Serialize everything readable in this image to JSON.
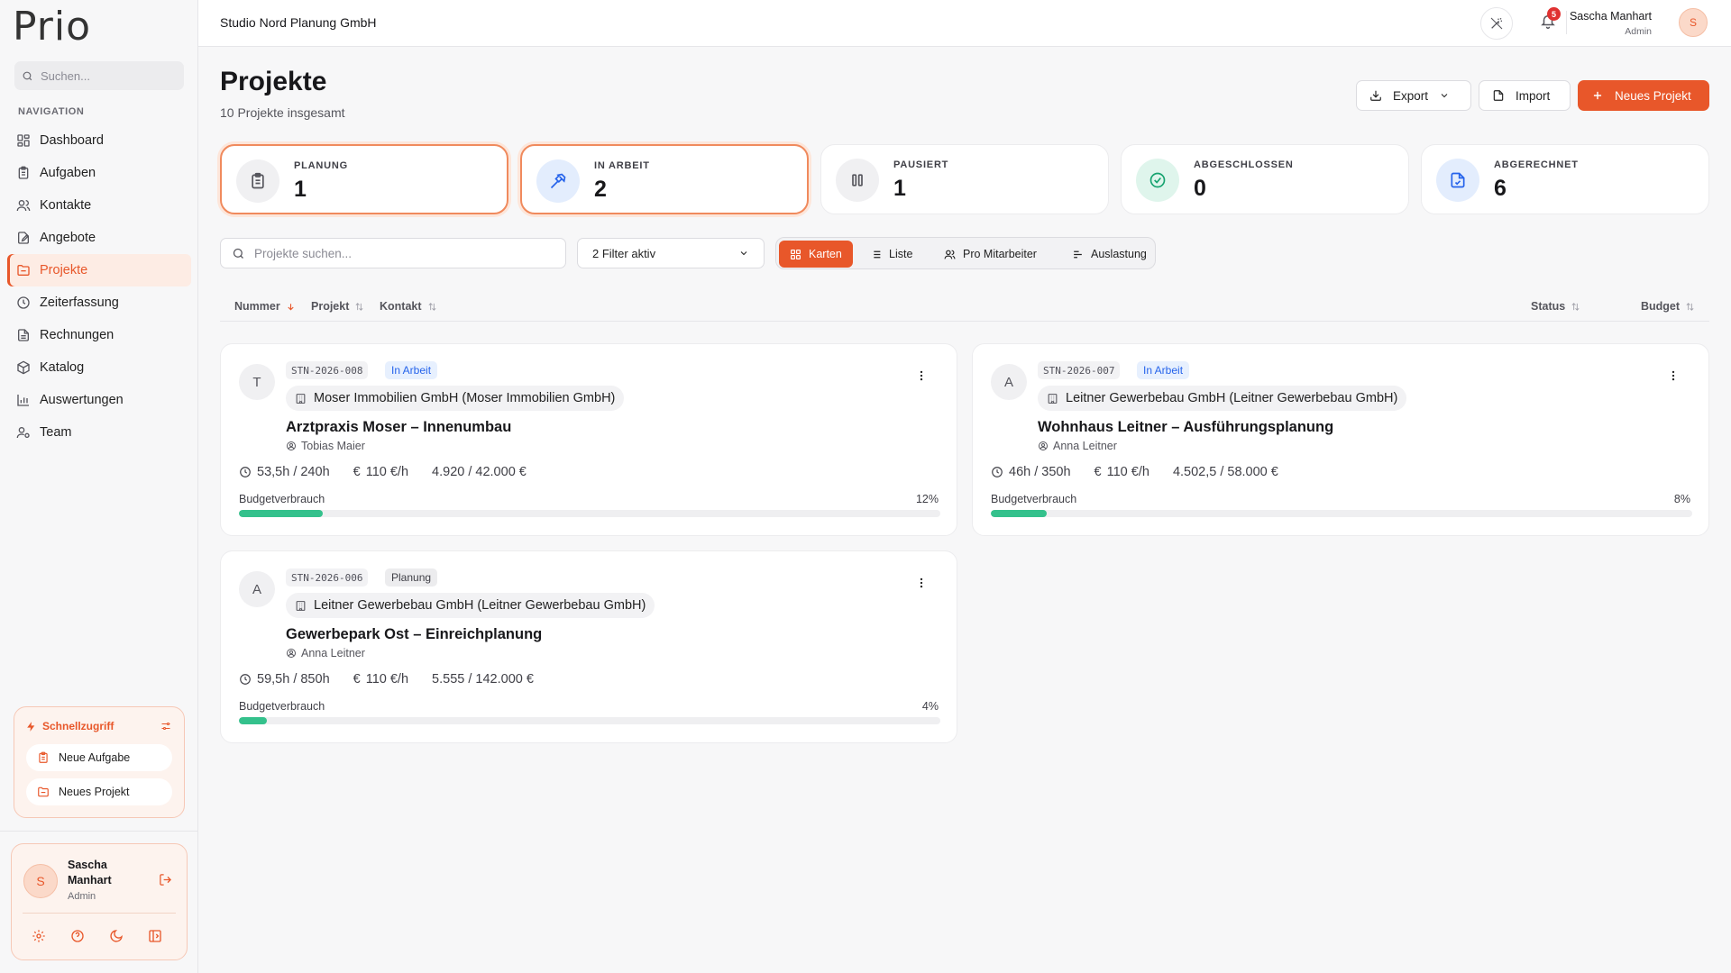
{
  "brand": {
    "logo": "Prio"
  },
  "sidebar": {
    "search_placeholder": "Suchen...",
    "nav_label": "NAVIGATION",
    "items": [
      {
        "label": "Dashboard",
        "icon": "dashboard-icon"
      },
      {
        "label": "Aufgaben",
        "icon": "clipboard-icon"
      },
      {
        "label": "Kontakte",
        "icon": "users-icon"
      },
      {
        "label": "Angebote",
        "icon": "file-edit-icon"
      },
      {
        "label": "Projekte",
        "icon": "folder-icon",
        "active": true
      },
      {
        "label": "Zeiterfassung",
        "icon": "clock-icon"
      },
      {
        "label": "Rechnungen",
        "icon": "receipt-icon"
      },
      {
        "label": "Katalog",
        "icon": "package-icon"
      },
      {
        "label": "Auswertungen",
        "icon": "bar-chart-icon"
      },
      {
        "label": "Team",
        "icon": "team-icon"
      }
    ],
    "quick": {
      "title": "Schnellzugriff",
      "items": [
        "Neue Aufgabe",
        "Neues Projekt"
      ]
    },
    "user": {
      "name": "Sascha Manhart",
      "role": "Admin",
      "initial": "S"
    }
  },
  "topbar": {
    "company": "Studio Nord Planung GmbH",
    "notifications": "5",
    "user_name": "Sascha Manhart",
    "user_role": "Admin",
    "user_initial": "S"
  },
  "page": {
    "title": "Projekte",
    "subtitle": "10 Projekte insgesamt",
    "export_label": "Export",
    "import_label": "Import",
    "new_label": "Neues Projekt"
  },
  "stats": [
    {
      "label": "PLANUNG",
      "value": "1"
    },
    {
      "label": "IN ARBEIT",
      "value": "2"
    },
    {
      "label": "PAUSIERT",
      "value": "1"
    },
    {
      "label": "ABGESCHLOSSEN",
      "value": "0"
    },
    {
      "label": "ABGERECHNET",
      "value": "6"
    }
  ],
  "toolbar": {
    "search_placeholder": "Projekte suchen...",
    "filter_label": "2 Filter aktiv",
    "views": [
      "Karten",
      "Liste",
      "Pro Mitarbeiter",
      "Auslastung"
    ]
  },
  "columns": {
    "nummer": "Nummer",
    "projekt": "Projekt",
    "kontakt": "Kontakt",
    "status": "Status",
    "budget": "Budget"
  },
  "projects": [
    {
      "initial": "T",
      "code": "STN-2026-008",
      "status": "In Arbeit",
      "contact": "Moser Immobilien GmbH (Moser Immobilien GmbH)",
      "name": "Arztpraxis Moser – Innenumbau",
      "owner": "Tobias Maier",
      "hours": "53,5h / 240h",
      "rate": "110 €/h",
      "budget": "4.920 / 42.000 €",
      "budget_label": "Budgetverbrauch",
      "percent_label": "12%",
      "percent": 12
    },
    {
      "initial": "A",
      "code": "STN-2026-007",
      "status": "In Arbeit",
      "contact": "Leitner Gewerbebau GmbH (Leitner Gewerbebau GmbH)",
      "name": "Wohnhaus Leitner – Ausführungsplanung",
      "owner": "Anna Leitner",
      "hours": "46h / 350h",
      "rate": "110 €/h",
      "budget": "4.502,5 / 58.000 €",
      "budget_label": "Budgetverbrauch",
      "percent_label": "8%",
      "percent": 8
    },
    {
      "initial": "A",
      "code": "STN-2026-006",
      "status": "Planung",
      "contact": "Leitner Gewerbebau GmbH (Leitner Gewerbebau GmbH)",
      "name": "Gewerbepark Ost – Einreichplanung",
      "owner": "Anna Leitner",
      "hours": "59,5h / 850h",
      "rate": "110 €/h",
      "budget": "5.555 / 142.000 €",
      "budget_label": "Budgetverbrauch",
      "percent_label": "4%",
      "percent": 4
    }
  ],
  "colors": {
    "accent": "#e8572a",
    "progress": "#34c18c",
    "status_blue": "#2563eb"
  }
}
